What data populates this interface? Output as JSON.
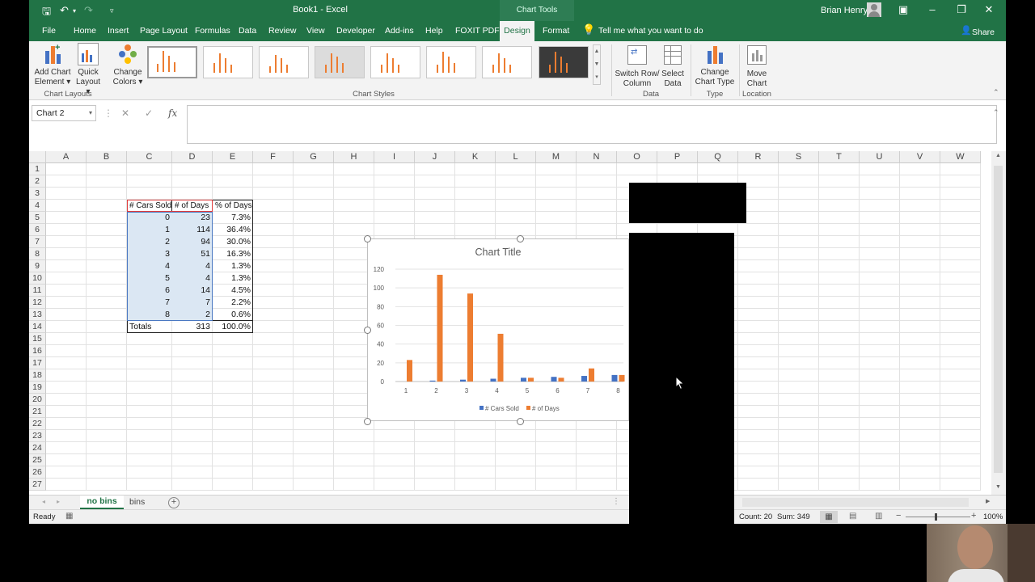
{
  "window": {
    "doc_title": "Book1 - Excel",
    "chart_tools_label": "Chart Tools",
    "user_name": "Brian Henry"
  },
  "tabs": [
    "File",
    "Home",
    "Insert",
    "Page Layout",
    "Formulas",
    "Data",
    "Review",
    "View",
    "Developer",
    "Add-ins",
    "Help",
    "FOXIT PDF"
  ],
  "context_tabs": {
    "design": "Design",
    "format": "Format"
  },
  "tell_me": "Tell me what you want to do",
  "share": "Share",
  "ribbon": {
    "add_chart_element": [
      "Add Chart",
      "Element"
    ],
    "quick_layout": [
      "Quick",
      "Layout"
    ],
    "change_colors": [
      "Change",
      "Colors"
    ],
    "switch_row_column": [
      "Switch Row/",
      "Column"
    ],
    "select_data": [
      "Select",
      "Data"
    ],
    "change_chart_type": [
      "Change",
      "Chart Type"
    ],
    "move_chart": [
      "Move",
      "Chart"
    ],
    "groups": {
      "chart_layouts": "Chart Layouts",
      "chart_styles": "Chart Styles",
      "data": "Data",
      "type": "Type",
      "location": "Location"
    }
  },
  "name_box": "Chart 2",
  "formula_fx": "fx",
  "columns": [
    "A",
    "B",
    "C",
    "D",
    "E",
    "F",
    "G",
    "H",
    "I",
    "J",
    "K",
    "L",
    "M",
    "N",
    "O",
    "P",
    "Q",
    "R",
    "S",
    "T",
    "U",
    "V",
    "W"
  ],
  "rows": [
    "1",
    "2",
    "3",
    "4",
    "5",
    "6",
    "7",
    "8",
    "9",
    "10",
    "11",
    "12",
    "13",
    "14",
    "15",
    "16",
    "17",
    "18",
    "19",
    "20",
    "21",
    "22",
    "23",
    "24",
    "25",
    "26",
    "27"
  ],
  "table": {
    "headers": [
      "# Cars Sold",
      "# of Days",
      "% of Days"
    ],
    "rows": [
      [
        "0",
        "23",
        "7.3%"
      ],
      [
        "1",
        "114",
        "36.4%"
      ],
      [
        "2",
        "94",
        "30.0%"
      ],
      [
        "3",
        "51",
        "16.3%"
      ],
      [
        "4",
        "4",
        "1.3%"
      ],
      [
        "5",
        "4",
        "1.3%"
      ],
      [
        "6",
        "14",
        "4.5%"
      ],
      [
        "7",
        "7",
        "2.2%"
      ],
      [
        "8",
        "2",
        "0.6%"
      ]
    ],
    "totals": [
      "Totals",
      "313",
      "100.0%"
    ]
  },
  "chart_data": {
    "type": "bar",
    "title": "Chart Title",
    "categories": [
      "1",
      "2",
      "3",
      "4",
      "5",
      "6",
      "7",
      "8"
    ],
    "series": [
      {
        "name": "# Cars Sold",
        "values": [
          0,
          1,
          2,
          3,
          4,
          5,
          6,
          7
        ],
        "color": "#4472c4"
      },
      {
        "name": "# of Days",
        "values": [
          23,
          114,
          94,
          51,
          4,
          4,
          14,
          7
        ],
        "color": "#ed7d31"
      }
    ],
    "ylim": [
      0,
      120
    ],
    "yticks": [
      "0",
      "20",
      "40",
      "60",
      "80",
      "100",
      "120"
    ],
    "grid": true,
    "legend": "bottom"
  },
  "sheets": {
    "active": "no bins",
    "other": "bins"
  },
  "status": {
    "ready": "Ready",
    "count": "Count: 20",
    "sum": "Sum: 349",
    "zoom": "100%"
  }
}
